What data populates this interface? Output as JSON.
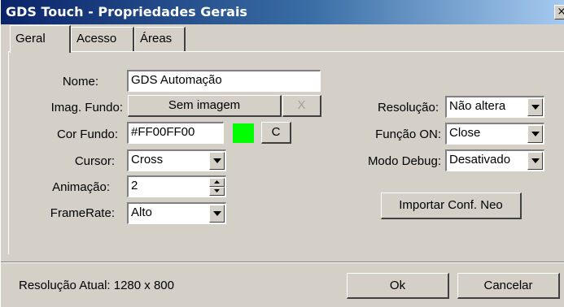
{
  "window": {
    "title": "GDS Touch - Propriedades Gerais",
    "close_glyph": "×"
  },
  "tabs": [
    {
      "label": "Geral",
      "active": true
    },
    {
      "label": "Acesso",
      "active": false
    },
    {
      "label": "Áreas",
      "active": false
    }
  ],
  "form": {
    "nome": {
      "label": "Nome:",
      "value": "GDS Automação"
    },
    "imag_fundo": {
      "label": "Imag. Fundo:",
      "button": "Sem imagem",
      "clear_glyph": "X"
    },
    "cor_fundo": {
      "label": "Cor Fundo:",
      "value": "#FF00FF00",
      "swatch_color": "#00ff00",
      "button": "C"
    },
    "cursor": {
      "label": "Cursor:",
      "value": "Cross"
    },
    "animacao": {
      "label": "Animação:",
      "value": "2"
    },
    "framerate": {
      "label": "FrameRate:",
      "value": "Alto"
    },
    "resolucao": {
      "label": "Resolução:",
      "value": "Não altera"
    },
    "funcao_on": {
      "label": "Função ON:",
      "value": "Close"
    },
    "modo_debug": {
      "label": "Modo Debug:",
      "value": "Desativado"
    },
    "import_button": "Importar Conf. Neo"
  },
  "footer": {
    "status": "Resolução Atual: 1280 x 800",
    "ok_label": "Ok",
    "cancel_label": "Cancelar"
  },
  "icons": {
    "dropdown": "chevron-down-icon",
    "spin_up": "spin-up-icon",
    "spin_down": "spin-down-icon"
  },
  "colors": {
    "title_start": "#0a246a",
    "title_end": "#a6caf0",
    "face": "#d4d0c8"
  }
}
